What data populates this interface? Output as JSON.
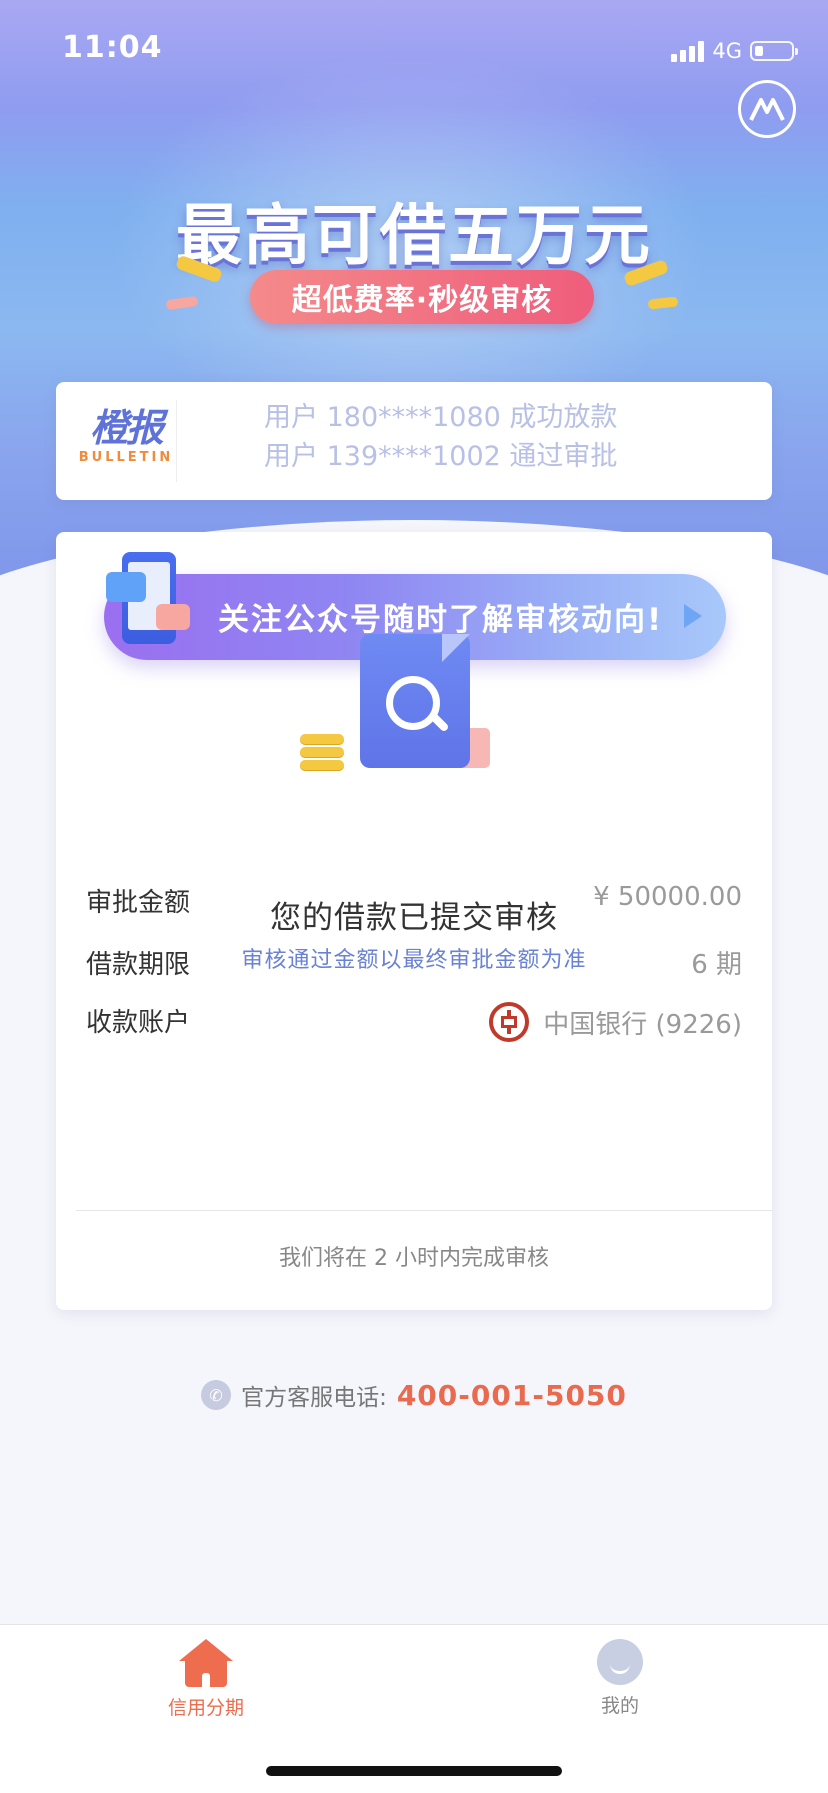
{
  "status_bar": {
    "time": "11:04",
    "network": "4G"
  },
  "hero": {
    "headline": "最高可借五万元",
    "pill": "超低费率·秒级审核"
  },
  "bulletin": {
    "logo_title": "橙报",
    "logo_sub": "BULLETIN",
    "lines": [
      "用户 180****1080 成功放款",
      "用户 139****1002 通过审批"
    ]
  },
  "banner": {
    "text": "关注公众号随时了解审核动向!"
  },
  "review": {
    "title": "您的借款已提交审核",
    "subtitle": "审核通过金额以最终审批金额为准",
    "rows": [
      {
        "label": "审批金额",
        "value": "¥ 50000.00"
      },
      {
        "label": "借款期限",
        "value": "6 期"
      },
      {
        "label": "收款账户",
        "value": "中国银行 (9226)"
      }
    ],
    "note": "我们将在 2 小时内完成审核"
  },
  "service": {
    "label": "官方客服电话:",
    "phone": "400-001-5050"
  },
  "tabbar": {
    "tabs": [
      {
        "label": "信用分期",
        "active": true
      },
      {
        "label": "我的",
        "active": false
      }
    ]
  },
  "colors": {
    "accent": "#ee6d4e",
    "primary": "#6a82d6",
    "hero_top": "#a9a8f2",
    "hero_bottom": "#7f95ea"
  }
}
